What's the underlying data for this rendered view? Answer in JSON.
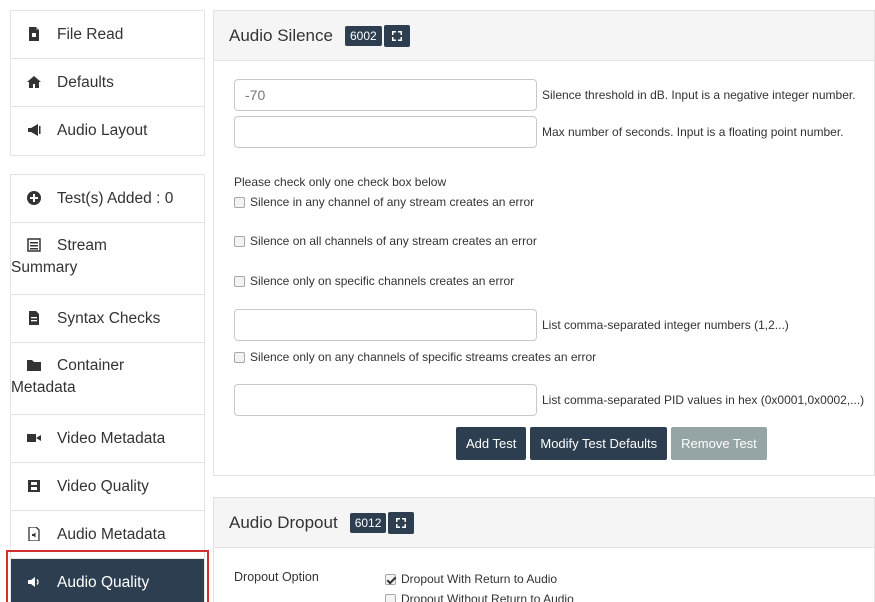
{
  "sidebar": {
    "group1": [
      {
        "label": "File Read",
        "icon": "file-icon"
      },
      {
        "label": "Defaults",
        "icon": "home-icon"
      },
      {
        "label": "Audio Layout",
        "icon": "megaphone-icon"
      }
    ],
    "group2": [
      {
        "label": "Test(s) Added : 0",
        "icon": "plus-circle-icon"
      },
      {
        "label_a": "Stream",
        "label_b": "Summary",
        "icon": "list-icon"
      },
      {
        "label": "Syntax Checks",
        "icon": "file-text-icon"
      },
      {
        "label_a": "Container",
        "label_b": "Metadata",
        "icon": "folder-icon"
      },
      {
        "label": "Video Metadata",
        "icon": "video-camera-icon"
      },
      {
        "label": "Video Quality",
        "icon": "film-icon"
      },
      {
        "label": "Audio Metadata",
        "icon": "audio-file-icon"
      },
      {
        "label": "Audio Quality",
        "icon": "volume-icon"
      }
    ]
  },
  "silence": {
    "title": "Audio Silence",
    "badge": "6002",
    "threshold_value": "-70",
    "threshold_hint": "Silence threshold in dB. Input is a negative integer number.",
    "seconds_value": "",
    "seconds_hint": "Max number of seconds. Input is a floating point number.",
    "note": "Please check only one check box below",
    "opt1": "Silence in any channel of any stream creates an error",
    "opt2": "Silence on all channels of any stream creates an error",
    "opt3": "Silence only on specific channels creates an error",
    "channels_value": "",
    "channels_hint": "List comma-separated integer numbers (1,2...)",
    "opt4": "Silence only on any channels of specific streams creates an error",
    "pids_value": "",
    "pids_hint": "List comma-separated PID values in hex (0x0001,0x0002,...)",
    "add_test": "Add Test",
    "modify_defaults": "Modify Test Defaults",
    "remove_test": "Remove Test"
  },
  "dropout": {
    "title": "Audio Dropout",
    "badge": "6012",
    "option_label": "Dropout Option",
    "opt1": "Dropout With Return to Audio",
    "opt2": "Dropout Without Return to Audio"
  },
  "colors": {
    "accent": "#2c3e50",
    "disabled": "#95a5a6",
    "highlight": "#d32f2f"
  }
}
